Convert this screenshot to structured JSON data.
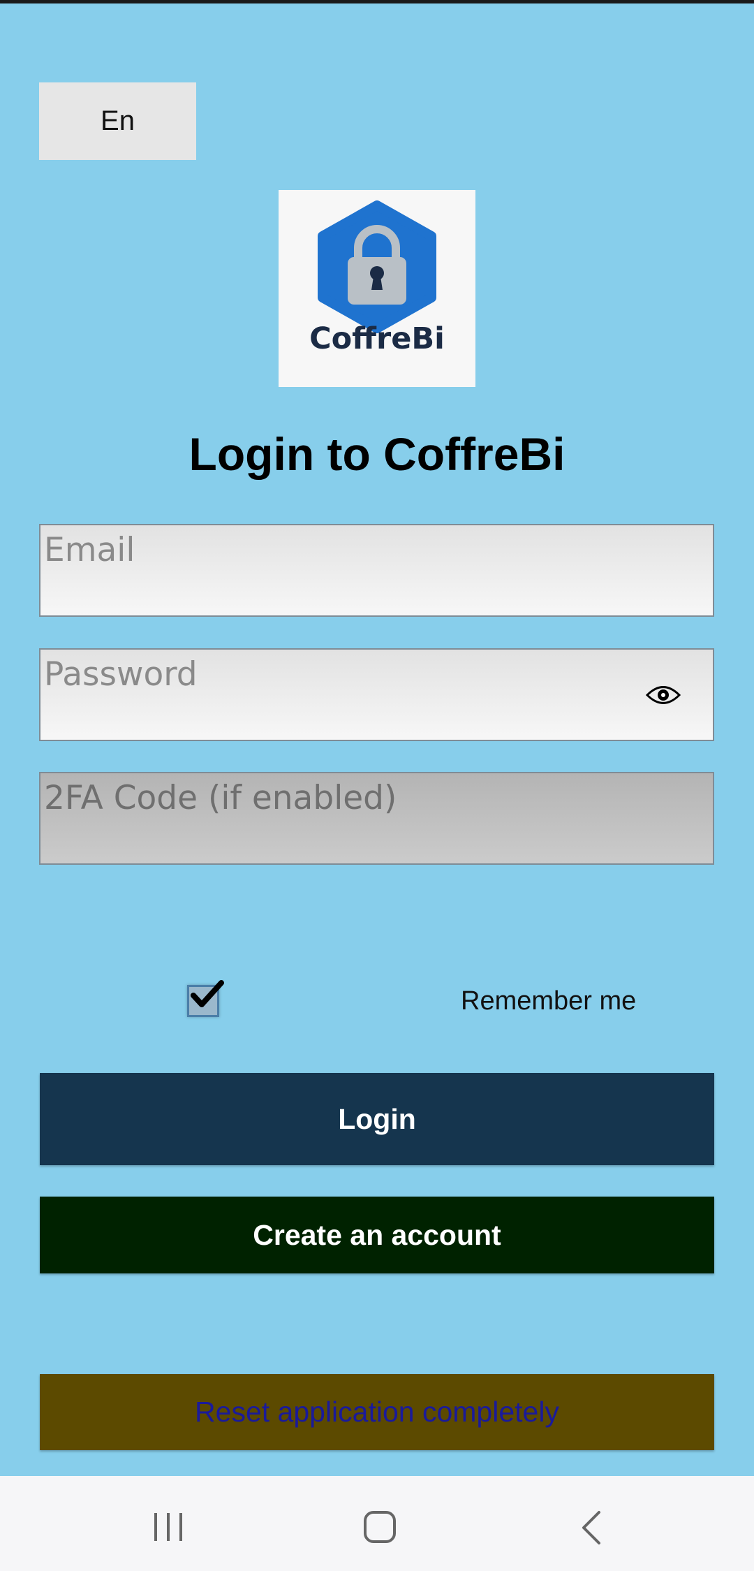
{
  "language_button": {
    "label": "En"
  },
  "logo": {
    "name": "CoffreBi"
  },
  "title": "Login to CoffreBi",
  "fields": {
    "email_placeholder": "Email",
    "password_placeholder": "Password",
    "twofa_placeholder": "2FA Code (if enabled)"
  },
  "remember": {
    "label": "Remember me",
    "checked": true
  },
  "buttons": {
    "login": "Login",
    "create_account": "Create an account",
    "reset": "Reset application completely"
  },
  "colors": {
    "background": "#87CEEB",
    "login_button": "#15354E",
    "create_button": "#002200",
    "reset_button": "#5C4A00",
    "reset_text": "#1A1A9A"
  },
  "icons": {
    "logo": "lock-hexagon-icon",
    "password_toggle": "eye-icon",
    "nav_recents": "recents-icon",
    "nav_home": "home-icon",
    "nav_back": "back-icon"
  }
}
